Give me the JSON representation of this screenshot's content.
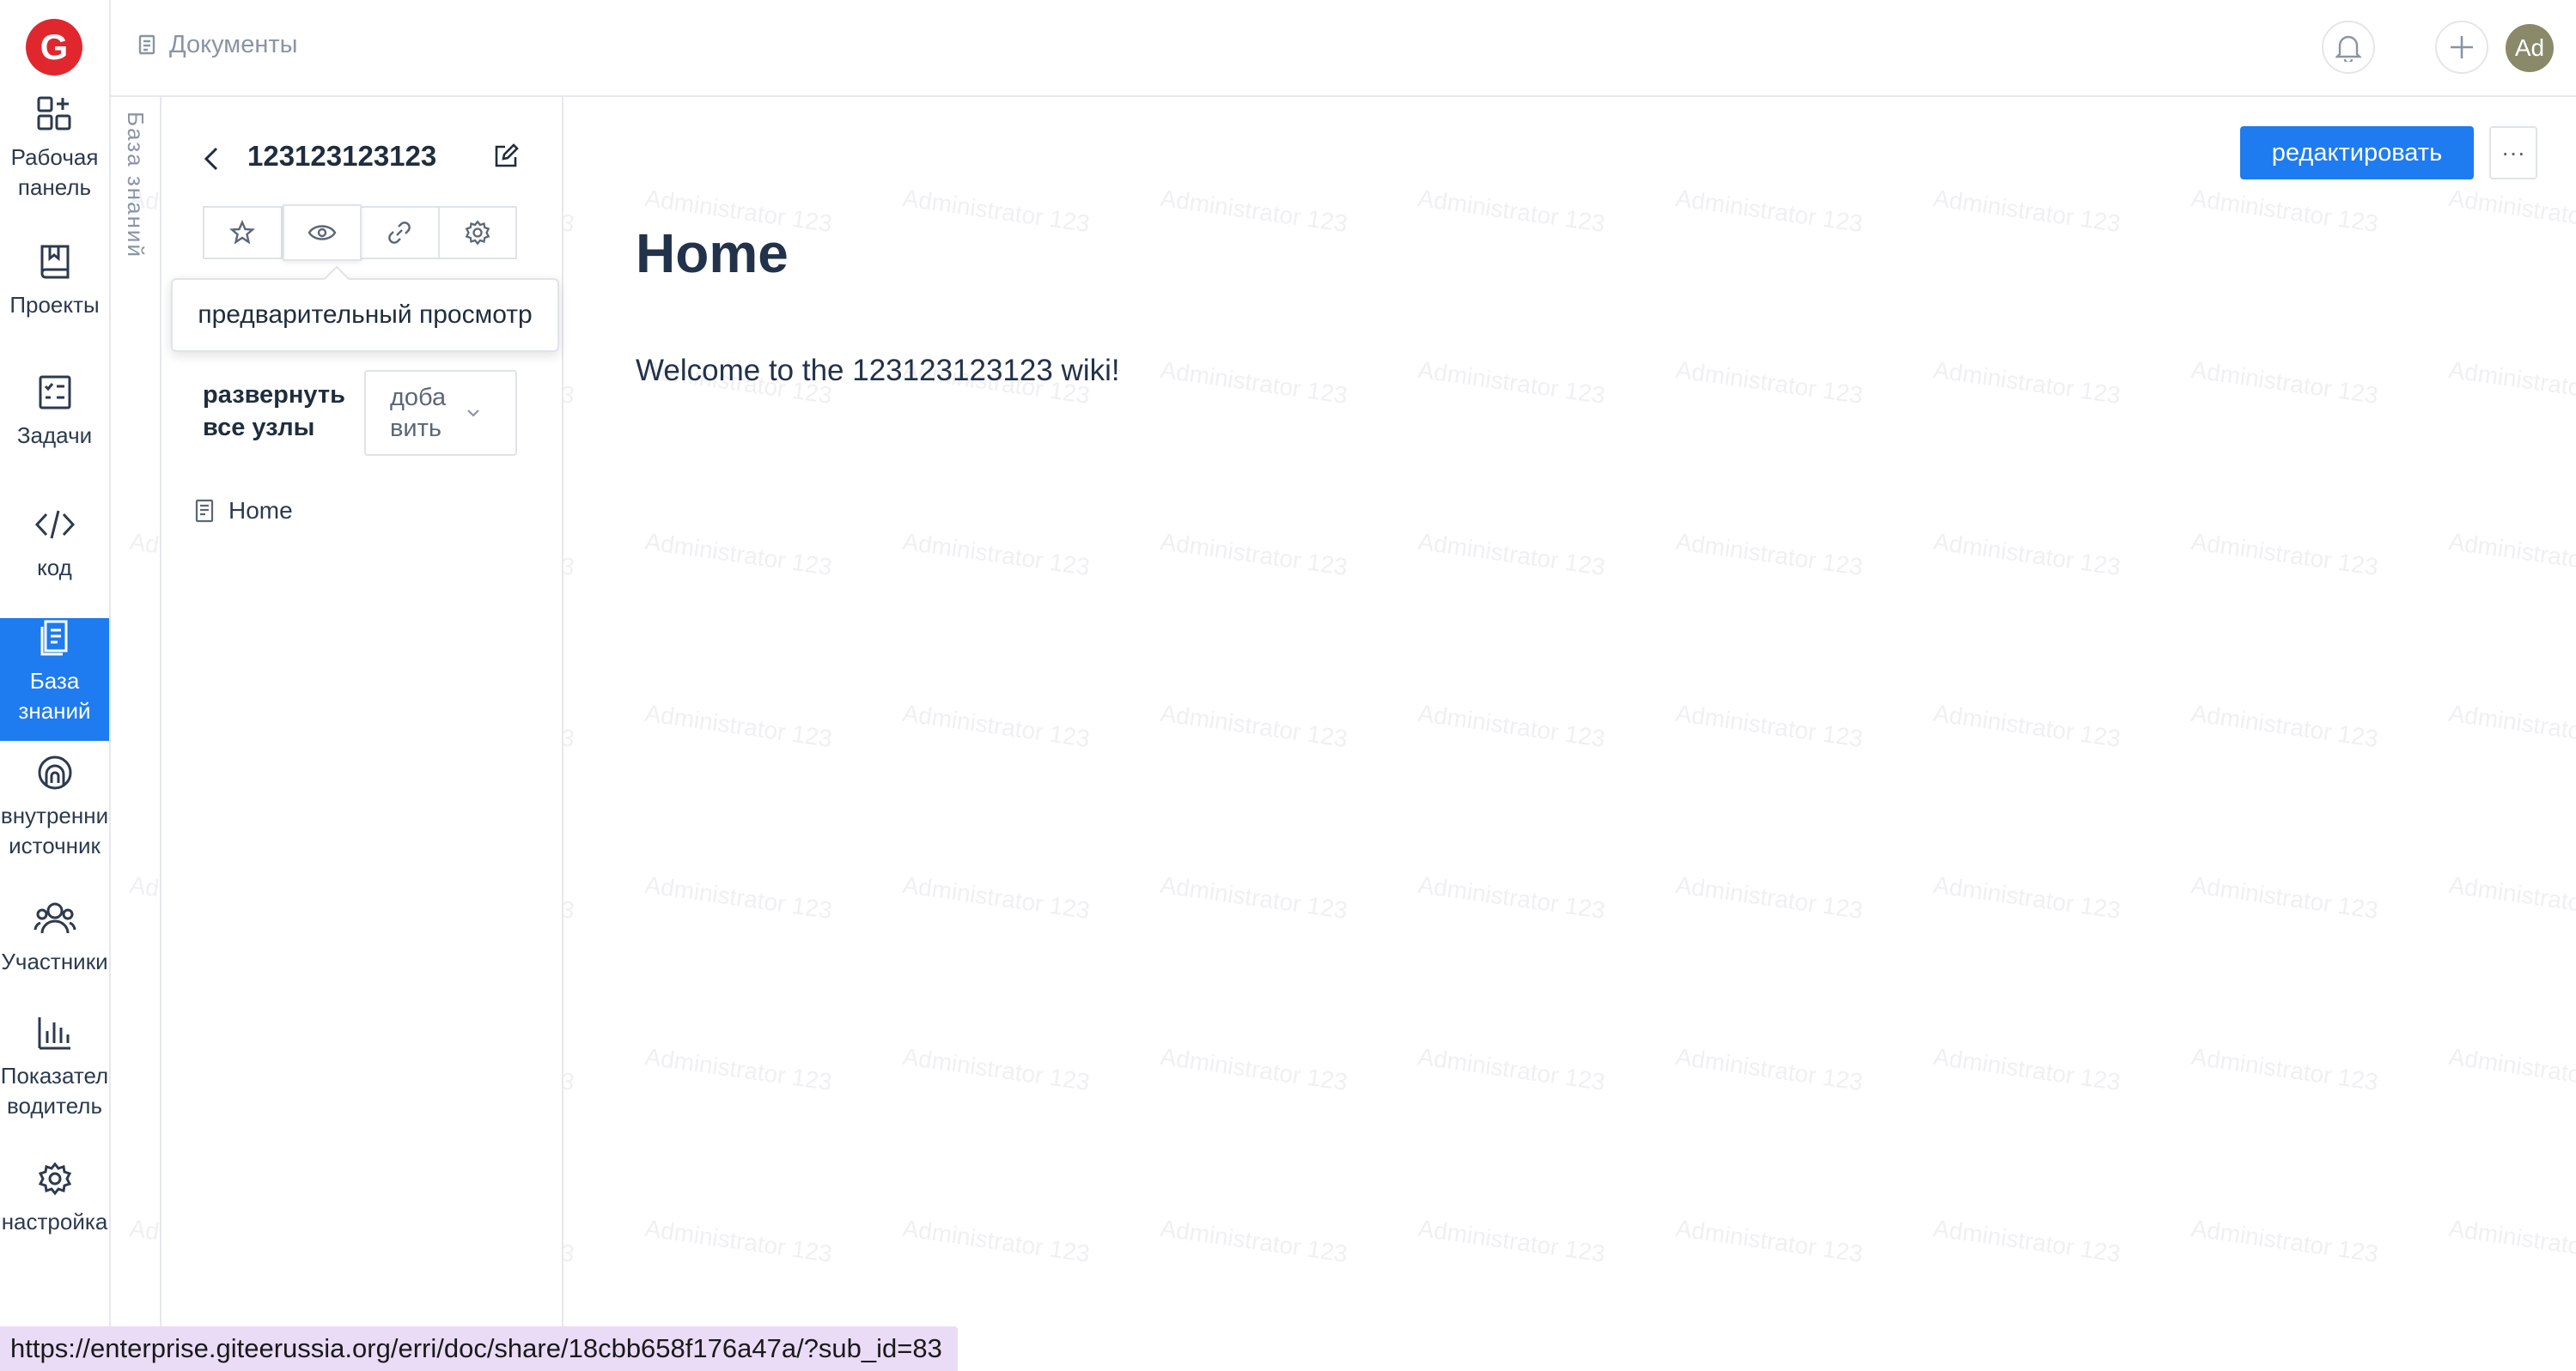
{
  "app": {
    "logo_letter": "G"
  },
  "nav": {
    "items": [
      {
        "lines": [
          "Рабочая",
          "панель"
        ],
        "icon": "dashboard-icon"
      },
      {
        "lines": [
          "Проекты"
        ],
        "icon": "book-icon"
      },
      {
        "lines": [
          "Задачи"
        ],
        "icon": "tasks-icon"
      },
      {
        "lines": [
          "код"
        ],
        "icon": "code-icon"
      },
      {
        "lines": [
          "База",
          "знаний"
        ],
        "icon": "document-icon",
        "active": true
      },
      {
        "lines": [
          "внутренни",
          "источник"
        ],
        "icon": "source-icon"
      },
      {
        "lines": [
          "Участники"
        ],
        "icon": "members-icon"
      },
      {
        "lines": [
          "Показател",
          "водитель"
        ],
        "icon": "bar-chart-icon"
      },
      {
        "lines": [
          "настройка"
        ],
        "icon": "gear-icon"
      }
    ]
  },
  "header": {
    "breadcrumb": "Документы",
    "avatar_text": "Ad"
  },
  "knowledge_base": {
    "vertical_tab": "База знаний",
    "title": "123123123123",
    "toolbar": [
      "star-icon",
      "eye-icon",
      "link-icon",
      "gear-icon"
    ],
    "tooltip": "предварительный просмотр",
    "expand_all": [
      "развернуть",
      "все узлы"
    ],
    "add_dropdown": [
      "доба",
      "вить"
    ],
    "tree": [
      {
        "label": "Home"
      }
    ]
  },
  "main": {
    "edit_button": "редактировать",
    "more_button": "···",
    "heading": "Home",
    "body": "Welcome to the 123123123123 wiki!"
  },
  "watermark": "Administrator 123",
  "status_url": "https://enterprise.giteerussia.org/erri/doc/share/18cbb658f176a47a/?sub_id=83",
  "colors": {
    "accent": "#1e7bf0",
    "logo": "#e0272d",
    "status_bg": "#eadcf7"
  }
}
